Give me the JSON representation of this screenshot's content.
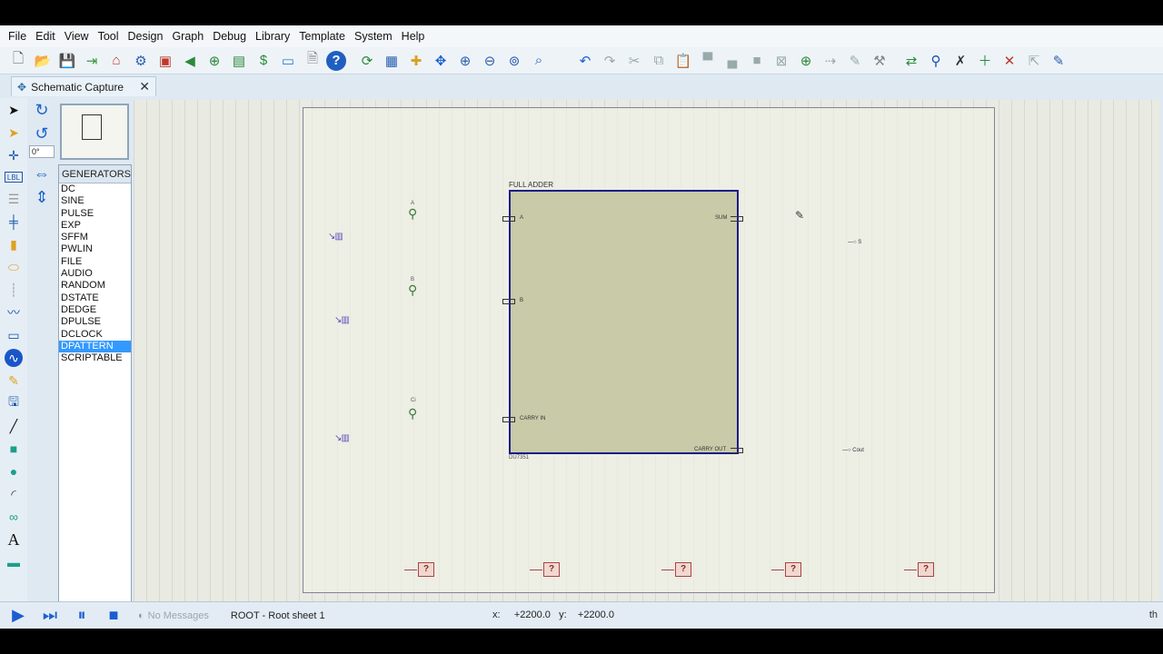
{
  "menu": [
    "File",
    "Edit",
    "View",
    "Tool",
    "Design",
    "Graph",
    "Debug",
    "Library",
    "Template",
    "System",
    "Help"
  ],
  "toolbar_icons": [
    "new-file-icon",
    "open-folder-icon",
    "save-icon",
    "import-icon",
    "home-icon",
    "component-icon",
    "chip-icon",
    "back-icon",
    "zoom-icon",
    "bom-icon",
    "dollar-icon",
    "netlist-icon",
    "document-icon",
    "help-icon",
    "refresh-icon",
    "grid-icon",
    "origin-icon",
    "pan-icon",
    "zoom-in-icon",
    "zoom-out-icon",
    "zoom-all-icon",
    "zoom-area-icon",
    "undo-icon",
    "redo-icon",
    "cut-icon",
    "copy-icon",
    "paste-icon",
    "block-copy-icon",
    "block-move-icon",
    "block-rotate-icon",
    "block-delete-icon",
    "pick-icon",
    "make-device-icon",
    "packaging-icon",
    "decompose-icon",
    "wire-autorouter-icon",
    "search-icon",
    "property-assign-icon",
    "new-sheet-icon",
    "remove-sheet-icon",
    "exit-sheet-icon",
    "design-explorer-icon"
  ],
  "tab": {
    "label": "Schematic Capture",
    "close": "✕"
  },
  "rotation": {
    "angle": "0°"
  },
  "generators": {
    "header": "GENERATORS",
    "items": [
      "DC",
      "SINE",
      "PULSE",
      "EXP",
      "SFFM",
      "PWLIN",
      "FILE",
      "AUDIO",
      "RANDOM",
      "DSTATE",
      "DEDGE",
      "DPULSE",
      "DCLOCK",
      "DPATTERN",
      "SCRIPTABLE"
    ],
    "selected": "DPATTERN"
  },
  "schematic": {
    "block_title": "FULL ADDER",
    "block_ref": "DU7351",
    "pins_left": [
      "A",
      "B",
      "CARRY IN"
    ],
    "pins_right": [
      "SUM",
      "CARRY OUT"
    ],
    "probe_labels": [
      "A",
      "B",
      "Ci"
    ],
    "outputs": [
      "S",
      "Cout"
    ]
  },
  "status": {
    "message": "No Messages",
    "sheet": "ROOT - Root sheet 1",
    "x_label": "x:",
    "x_value": "+2200.0",
    "y_label": "y:",
    "y_value": "+2200.0",
    "right": "th"
  }
}
